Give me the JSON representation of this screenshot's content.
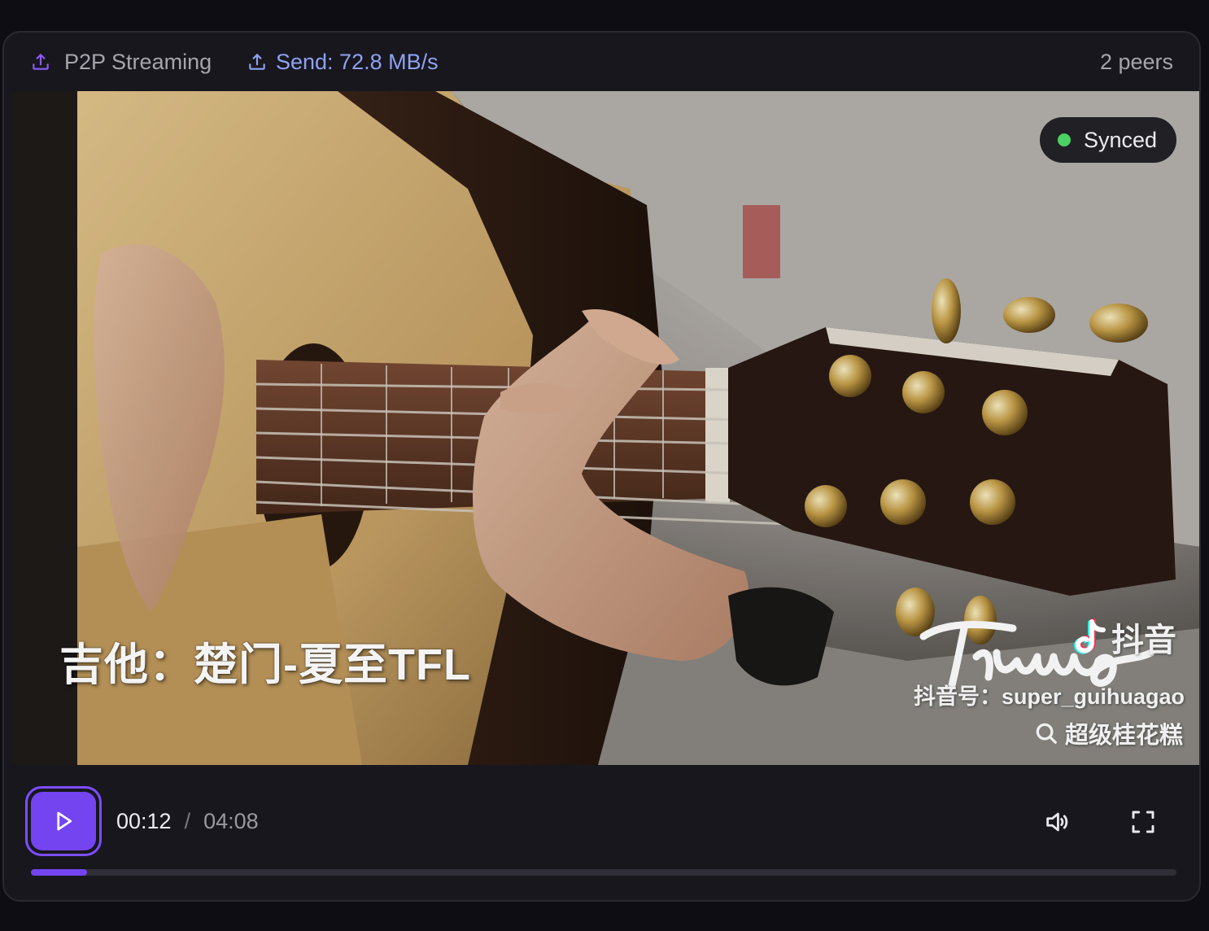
{
  "header": {
    "stream_label": "P2P Streaming",
    "send_rate": "Send: 72.8 MB/s",
    "peers": "2 peers",
    "stream_icon": "upload-icon",
    "send_icon": "upload-icon"
  },
  "video": {
    "sync_status": "Synced",
    "subtitle": "吉他：楚门-夏至TFL",
    "watermark": {
      "brand": "抖音",
      "account": "抖音号：super_guihuagao",
      "search_text": "超级桂花糕",
      "signature": "Trumon"
    }
  },
  "controls": {
    "current_time": "00:12",
    "separator": "/",
    "total_time": "04:08",
    "progress_fraction": 0.049,
    "play_icon": "play-icon",
    "volume_icon": "volume-icon",
    "fullscreen_icon": "fullscreen-icon"
  },
  "colors": {
    "accent": "#7444f0",
    "send_rate": "#8ea2f0",
    "synced_dot": "#4cd164",
    "panel_bg": "#18171e"
  }
}
